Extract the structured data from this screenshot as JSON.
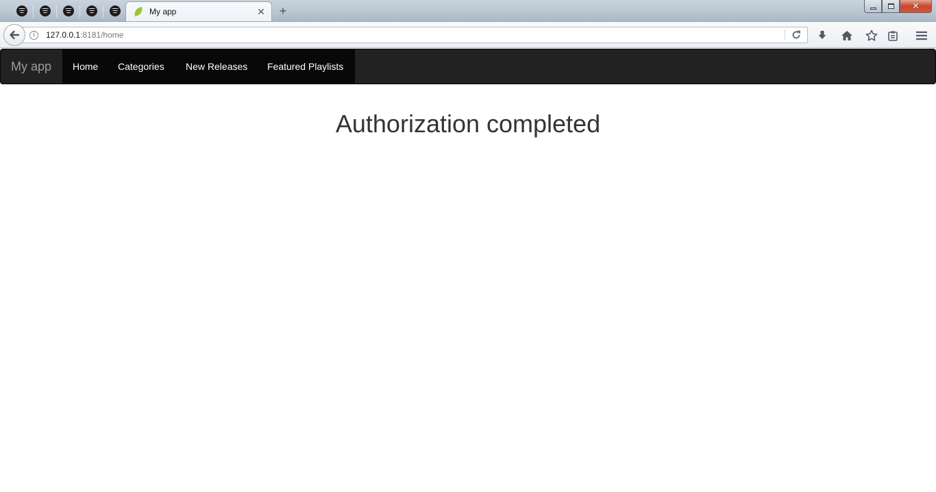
{
  "browser": {
    "pinned_tabs": [
      {
        "icon": "spotify-icon"
      },
      {
        "icon": "spotify-icon"
      },
      {
        "icon": "spotify-icon"
      },
      {
        "icon": "spotify-icon"
      },
      {
        "icon": "spotify-icon"
      }
    ],
    "active_tab": {
      "title": "My app",
      "icon": "leaf-icon",
      "close_glyph": "✕"
    },
    "new_tab_glyph": "+",
    "url": {
      "host": "127.0.0.1",
      "rest": ":8181/home"
    }
  },
  "app": {
    "brand": "My app",
    "nav": [
      {
        "label": "Home"
      },
      {
        "label": "Categories"
      },
      {
        "label": "New Releases"
      },
      {
        "label": "Featured Playlists"
      }
    ]
  },
  "main": {
    "title": "Authorization completed"
  },
  "colors": {
    "navbar_bg": "#222222",
    "navbar_active_bg": "#080808",
    "brand_text": "#9d9d9d",
    "nav_text": "#ffffff",
    "title_text": "#333333"
  }
}
